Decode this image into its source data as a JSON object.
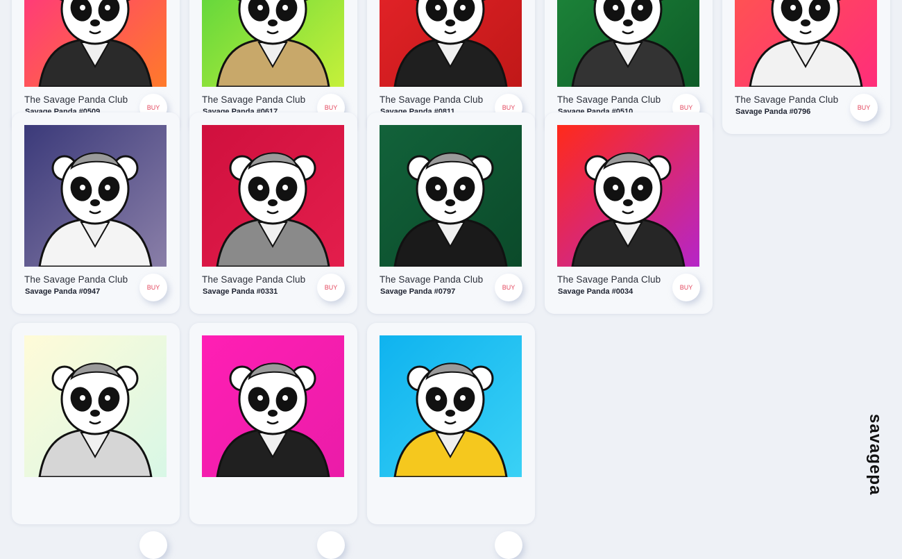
{
  "cards": [
    {
      "collection": "The Savage Panda Club",
      "name": "Savage Panda #0509",
      "buy_label": "BUY",
      "image": "panda-suspenders-pink",
      "bg": [
        "#ff2d8a",
        "#ff7a2a"
      ],
      "outfit": "#2a2a2a"
    },
    {
      "collection": "The Savage Panda Club",
      "name": "Savage Panda #0617",
      "buy_label": "BUY",
      "image": "panda-logs-green",
      "bg": [
        "#4fd23c",
        "#c6f03a"
      ],
      "outfit": "#c8a86a"
    },
    {
      "collection": "The Savage Panda Club",
      "name": "Savage Panda #0811",
      "buy_label": "BUY",
      "image": "panda-gold-chain-red",
      "bg": [
        "#e8242a",
        "#c01818"
      ],
      "outfit": "#1f1f1f"
    },
    {
      "collection": "The Savage Panda Club",
      "name": "Savage Panda #0510",
      "buy_label": "BUY",
      "image": "panda-armor-green",
      "bg": [
        "#1f8a3c",
        "#0e5c28"
      ],
      "outfit": "#333333"
    },
    {
      "collection": "The Savage Panda Club",
      "name": "Savage Panda #0796",
      "buy_label": "BUY",
      "image": "panda-skeleton-coral",
      "bg": [
        "#ff5a4a",
        "#ff2d7a"
      ],
      "outfit": "#f2f2f2"
    },
    {
      "collection": "The Savage Panda Club",
      "name": "Savage Panda #0947",
      "buy_label": "BUY",
      "image": "panda-chef-cigarette",
      "bg": [
        "#3b3a7a",
        "#8a7fa8"
      ],
      "outfit": "#f4f4f4"
    },
    {
      "collection": "The Savage Panda Club",
      "name": "Savage Panda #0331",
      "buy_label": "BUY",
      "image": "panda-duct-tape",
      "bg": [
        "#d0103e",
        "#e31e4c"
      ],
      "outfit": "#8a8a8a"
    },
    {
      "collection": "The Savage Panda Club",
      "name": "Savage Panda #0797",
      "buy_label": "BUY",
      "image": "panda-crown-rifles",
      "bg": [
        "#12623a",
        "#0b4a2a"
      ],
      "outfit": "#1a1a1a"
    },
    {
      "collection": "The Savage Panda Club",
      "name": "Savage Panda #0034",
      "buy_label": "BUY",
      "image": "panda-tv-head",
      "bg": [
        "#ff2a1a",
        "#b526c8"
      ],
      "outfit": "#262626"
    },
    {
      "collection": "",
      "name": "",
      "buy_label": "",
      "image": "panda-cowboy-hat",
      "bg": [
        "#fffbd8",
        "#d8f7e6"
      ],
      "outfit": "#d6d6d6"
    },
    {
      "collection": "",
      "name": "",
      "buy_label": "",
      "image": "panda-keep-out-tape",
      "bg": [
        "#ff1fb4",
        "#ea1ca8"
      ],
      "outfit": "#202020"
    },
    {
      "collection": "",
      "name": "",
      "buy_label": "",
      "image": "panda-rocket-lemonade",
      "bg": [
        "#0fb3ef",
        "#3ad1f5"
      ],
      "outfit": "#f5c81e"
    }
  ],
  "side_logo": "savagepa"
}
